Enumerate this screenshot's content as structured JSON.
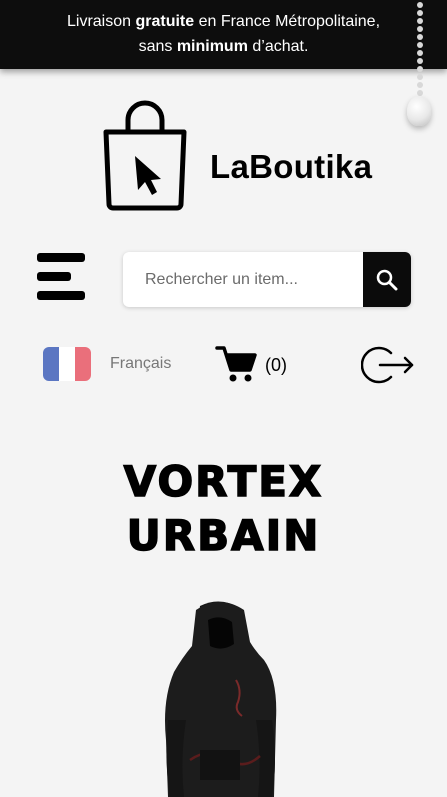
{
  "banner": {
    "part1": "Livraison ",
    "bold1": "gratuite",
    "part2": " en France Métropolitaine,",
    "part3": "sans ",
    "bold2": "minimum",
    "part4": " d’achat."
  },
  "brand": {
    "name": "LaBoutika"
  },
  "search": {
    "placeholder": "Rechercher un item..."
  },
  "language": {
    "label": "Français",
    "flag_colors": [
      "#5b76c2",
      "#ffffff",
      "#ea6f7b"
    ]
  },
  "cart": {
    "count": "(0)"
  },
  "hero": {
    "line1": "VORTEX",
    "line2": "URBAIN"
  },
  "icons": {
    "logo": "shopping-bag-cursor-icon",
    "menu": "menu-icon",
    "search": "search-icon",
    "cart": "cart-icon",
    "logout": "logout-icon"
  },
  "colors": {
    "banner_bg": "#0d0d0d",
    "page_bg": "#f4f4f4",
    "accent": "#000000"
  }
}
